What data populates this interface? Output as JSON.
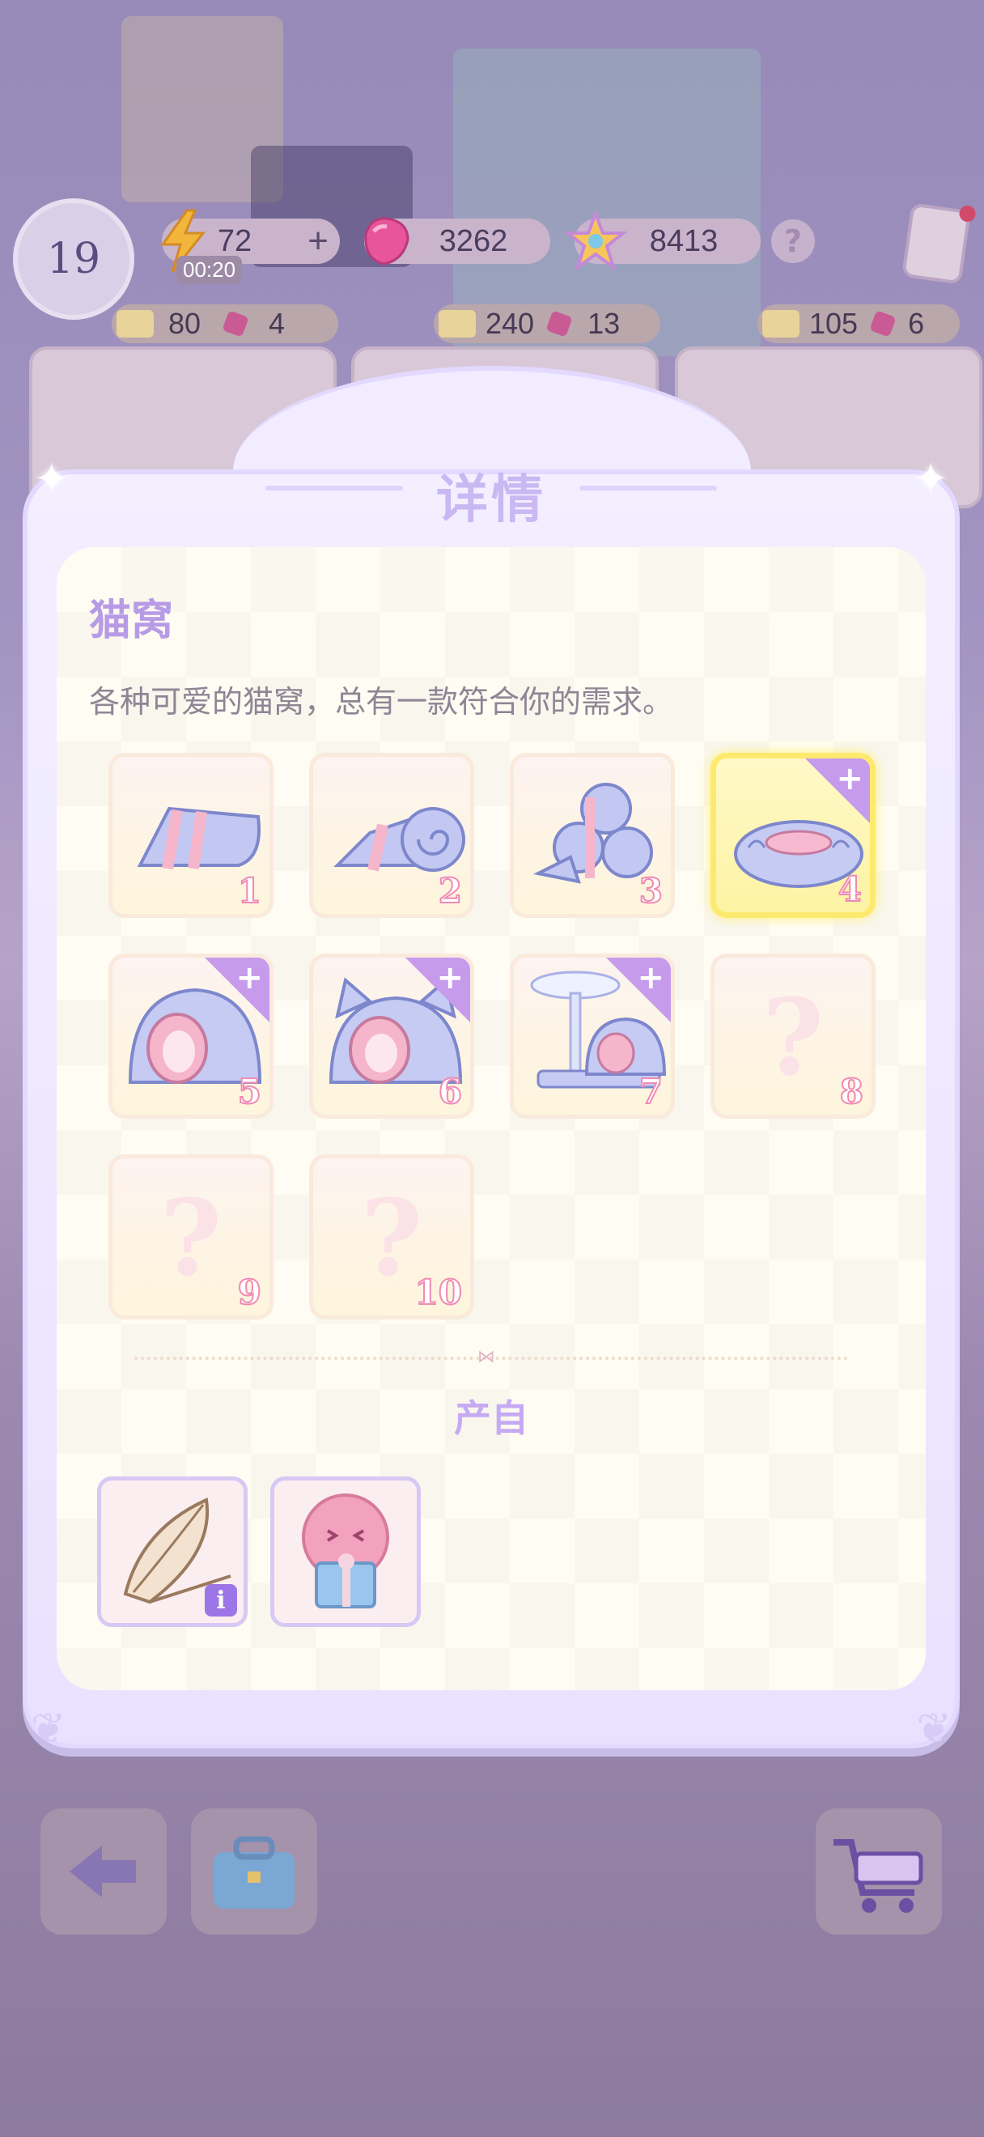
{
  "hud": {
    "level": "19",
    "energy": "72",
    "energy_plus": "+",
    "energy_timer": "00:20",
    "gems": "3262",
    "stars": "8413",
    "help": "?"
  },
  "shop_costs": [
    {
      "ticket": "80",
      "gem": "4"
    },
    {
      "ticket": "240",
      "gem": "13"
    },
    {
      "ticket": "105",
      "gem": "6"
    }
  ],
  "modal": {
    "title": "详情",
    "item_name": "猫窝",
    "item_desc": "各种可爱的猫窝，总有一款符合你的需求。",
    "levels": [
      {
        "num": "1",
        "icon": "blanket-icon",
        "unlocked": true,
        "selected": false,
        "plus": false
      },
      {
        "num": "2",
        "icon": "rolled-blanket-icon",
        "unlocked": true,
        "selected": false,
        "plus": false
      },
      {
        "num": "3",
        "icon": "blanket-rolls-stack-icon",
        "unlocked": true,
        "selected": false,
        "plus": false
      },
      {
        "num": "4",
        "icon": "round-cushion-bed-icon",
        "unlocked": true,
        "selected": true,
        "plus": true
      },
      {
        "num": "5",
        "icon": "dome-cat-bed-icon",
        "unlocked": true,
        "selected": false,
        "plus": true
      },
      {
        "num": "6",
        "icon": "cat-ear-bed-icon",
        "unlocked": true,
        "selected": false,
        "plus": true
      },
      {
        "num": "7",
        "icon": "cat-tree-bed-icon",
        "unlocked": true,
        "selected": false,
        "plus": true
      },
      {
        "num": "8",
        "icon": "unknown-icon",
        "unlocked": false,
        "selected": false,
        "plus": false
      },
      {
        "num": "9",
        "icon": "unknown-icon",
        "unlocked": false,
        "selected": false,
        "plus": false
      },
      {
        "num": "10",
        "icon": "unknown-icon",
        "unlocked": false,
        "selected": false,
        "plus": false
      }
    ],
    "unknown_mark": "?",
    "source_title": "产自",
    "sources": [
      {
        "icon": "cotton-pod-icon",
        "info": "i"
      },
      {
        "icon": "pink-ghost-gift-icon"
      }
    ]
  },
  "colors": {
    "accent_purple": "#b89be6",
    "selected_yellow": "#fde96d",
    "number_pink": "#f08ab4"
  }
}
